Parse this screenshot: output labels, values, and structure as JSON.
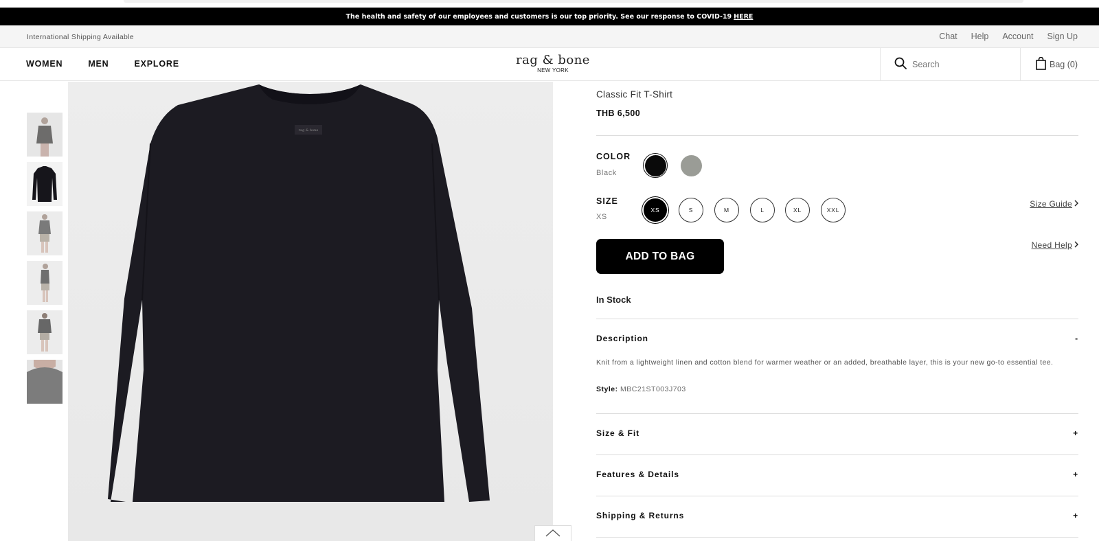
{
  "banner": {
    "text": "The health and safety of our employees and customers is our top priority. See our response to COVID-19",
    "link": "HERE"
  },
  "utility": {
    "shipping": "International Shipping Available",
    "links": [
      "Chat",
      "Help",
      "Account",
      "Sign Up"
    ]
  },
  "nav": {
    "menu": [
      "WOMEN",
      "MEN",
      "EXPLORE"
    ],
    "logo": {
      "main": "rag & bone",
      "sub": "NEW YORK"
    },
    "search_placeholder": "Search",
    "bag": "Bag (0)"
  },
  "product": {
    "name": "Classic Fit T-Shirt",
    "price": "THB 6,500",
    "color": {
      "label": "COLOR",
      "selected": "Black",
      "swatches": [
        {
          "name": "black-swatch",
          "color": "#0a0a0a"
        },
        {
          "name": "grey-swatch",
          "color": "#9a9c96"
        }
      ]
    },
    "size": {
      "label": "SIZE",
      "selected": "XS",
      "options": [
        "XS",
        "S",
        "M",
        "L",
        "XL",
        "XXL"
      ],
      "guide": "Size Guide"
    },
    "need_help": "Need Help",
    "add_to_bag": "ADD TO BAG",
    "stock": "In Stock",
    "description": {
      "title": "Description",
      "toggle": "-",
      "body": "Knit from a lightweight linen and cotton blend for warmer weather or an added, breathable layer, this is your new go-to essential tee.",
      "style_label": "Style:",
      "style_value": "MBC21ST003J703"
    },
    "accordions": [
      {
        "title": "Size & Fit",
        "toggle": "+"
      },
      {
        "title": "Features & Details",
        "toggle": "+"
      },
      {
        "title": "Shipping & Returns",
        "toggle": "+"
      }
    ],
    "garment_color": "#1c1b22"
  }
}
